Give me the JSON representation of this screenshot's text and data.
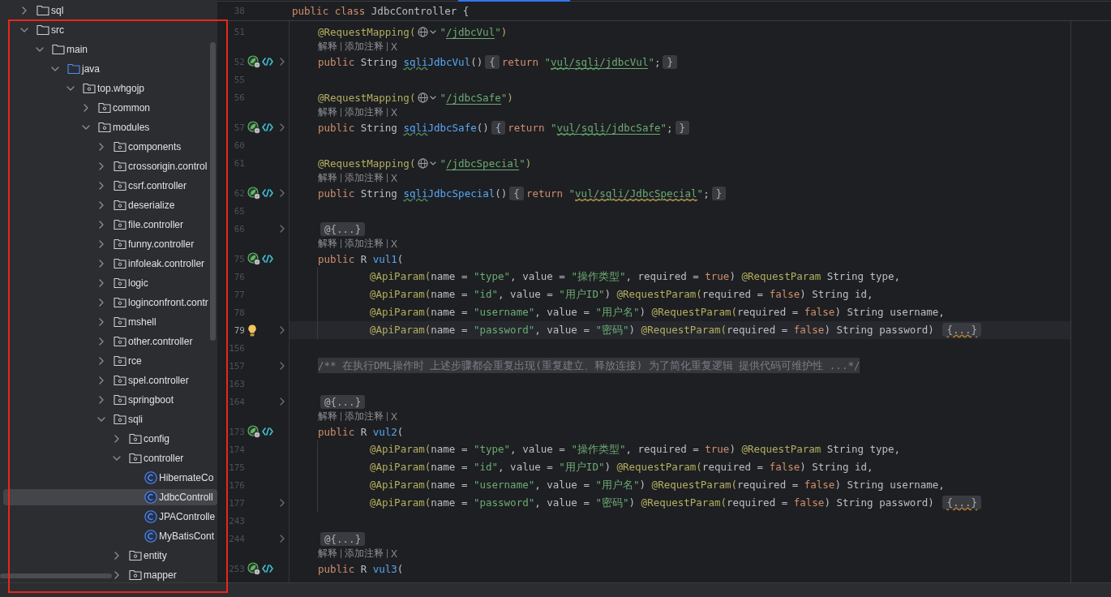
{
  "project_tree": {
    "items": [
      {
        "label": "sql",
        "kind": "folder",
        "expanded": false,
        "selected": false
      },
      {
        "label": "src",
        "kind": "folder",
        "expanded": true,
        "selected": false,
        "children": [
          {
            "label": "main",
            "kind": "folder",
            "expanded": true,
            "selected": false,
            "children": [
              {
                "label": "java",
                "kind": "source-folder",
                "expanded": true,
                "selected": false,
                "children": [
                  {
                    "label": "top.whgojp",
                    "kind": "package",
                    "expanded": true,
                    "selected": false,
                    "children": [
                      {
                        "label": "common",
                        "kind": "package",
                        "expanded": false,
                        "selected": false
                      },
                      {
                        "label": "modules",
                        "kind": "package",
                        "expanded": true,
                        "selected": false,
                        "children": [
                          {
                            "label": "components",
                            "kind": "package",
                            "expanded": false,
                            "selected": false
                          },
                          {
                            "label": "crossorigin.control",
                            "kind": "package",
                            "expanded": false,
                            "selected": false
                          },
                          {
                            "label": "csrf.controller",
                            "kind": "package",
                            "expanded": false,
                            "selected": false
                          },
                          {
                            "label": "deserialize",
                            "kind": "package",
                            "expanded": false,
                            "selected": false
                          },
                          {
                            "label": "file.controller",
                            "kind": "package",
                            "expanded": false,
                            "selected": false
                          },
                          {
                            "label": "funny.controller",
                            "kind": "package",
                            "expanded": false,
                            "selected": false
                          },
                          {
                            "label": "infoleak.controller",
                            "kind": "package",
                            "expanded": false,
                            "selected": false
                          },
                          {
                            "label": "logic",
                            "kind": "package",
                            "expanded": false,
                            "selected": false
                          },
                          {
                            "label": "loginconfront.contr",
                            "kind": "package",
                            "expanded": false,
                            "selected": false
                          },
                          {
                            "label": "mshell",
                            "kind": "package",
                            "expanded": false,
                            "selected": false
                          },
                          {
                            "label": "other.controller",
                            "kind": "package",
                            "expanded": false,
                            "selected": false
                          },
                          {
                            "label": "rce",
                            "kind": "package",
                            "expanded": false,
                            "selected": false
                          },
                          {
                            "label": "spel.controller",
                            "kind": "package",
                            "expanded": false,
                            "selected": false
                          },
                          {
                            "label": "springboot",
                            "kind": "package",
                            "expanded": false,
                            "selected": false
                          },
                          {
                            "label": "sqli",
                            "kind": "package",
                            "expanded": true,
                            "selected": false,
                            "children": [
                              {
                                "label": "config",
                                "kind": "package",
                                "expanded": false,
                                "selected": false
                              },
                              {
                                "label": "controller",
                                "kind": "package",
                                "expanded": true,
                                "selected": false,
                                "children": [
                                  {
                                    "label": "HibernateCo",
                                    "kind": "class",
                                    "selected": false
                                  },
                                  {
                                    "label": "JdbcControll",
                                    "kind": "class",
                                    "selected": true
                                  },
                                  {
                                    "label": "JPAControlle",
                                    "kind": "class",
                                    "selected": false
                                  },
                                  {
                                    "label": "MyBatisCont",
                                    "kind": "class",
                                    "selected": false
                                  }
                                ]
                              },
                              {
                                "label": "entity",
                                "kind": "package",
                                "expanded": false,
                                "selected": false
                              },
                              {
                                "label": "mapper",
                                "kind": "package",
                                "expanded": false,
                                "selected": false
                              }
                            ]
                          }
                        ]
                      }
                    ]
                  }
                ]
              }
            ]
          }
        ]
      }
    ]
  },
  "editor": {
    "sticky_line": {
      "number": "38",
      "kind": "header",
      "tokens": [
        {
          "kind": "keyword",
          "text": "public class "
        },
        {
          "kind": "plain",
          "text": "JdbcController {"
        }
      ]
    },
    "lines": [
      {
        "number": "51",
        "kind": "member",
        "current": false,
        "folded": false,
        "tokens": [
          {
            "kind": "annotation",
            "text": "@RequestMapping("
          },
          {
            "kind": "url-picker"
          },
          {
            "kind": "string",
            "text": "\""
          },
          {
            "kind": "url",
            "text": "/jdbcVul"
          },
          {
            "kind": "string",
            "text": "\""
          },
          {
            "kind": "annotation",
            "text": ")"
          }
        ]
      },
      {
        "kind": "inlay",
        "actions": [
          "解释",
          "添加注释",
          "X"
        ]
      },
      {
        "number": "52",
        "kind": "member",
        "gutter": {
          "kind": "endpoint"
        },
        "current": false,
        "folded": true,
        "tokens": [
          {
            "kind": "keyword",
            "text": "public "
          },
          {
            "kind": "plain",
            "text": "String "
          },
          {
            "kind": "method-typo",
            "text": "sqli"
          },
          {
            "kind": "method",
            "text": "JdbcVul"
          },
          {
            "kind": "plain",
            "text": "()"
          },
          {
            "kind": "fold",
            "text": "{"
          },
          {
            "kind": "keyword",
            "text": "return "
          },
          {
            "kind": "string",
            "text": "\""
          },
          {
            "kind": "url-typo",
            "text": "vul"
          },
          {
            "kind": "url",
            "text": "/"
          },
          {
            "kind": "url-typo",
            "text": "sqli"
          },
          {
            "kind": "url",
            "text": "/jdbcVul"
          },
          {
            "kind": "string",
            "text": "\""
          },
          {
            "kind": "plain",
            "text": ";"
          },
          {
            "kind": "fold",
            "text": "}"
          }
        ]
      },
      {
        "number": "55",
        "kind": "blank",
        "current": false,
        "folded": false
      },
      {
        "number": "56",
        "kind": "member",
        "current": false,
        "folded": false,
        "tokens": [
          {
            "kind": "annotation",
            "text": "@RequestMapping("
          },
          {
            "kind": "url-picker"
          },
          {
            "kind": "string",
            "text": "\""
          },
          {
            "kind": "url",
            "text": "/jdbcSafe"
          },
          {
            "kind": "string",
            "text": "\""
          },
          {
            "kind": "annotation",
            "text": ")"
          }
        ]
      },
      {
        "kind": "inlay",
        "actions": [
          "解释",
          "添加注释",
          "X"
        ]
      },
      {
        "number": "57",
        "kind": "member",
        "gutter": {
          "kind": "endpoint"
        },
        "current": false,
        "folded": true,
        "tokens": [
          {
            "kind": "keyword",
            "text": "public "
          },
          {
            "kind": "plain",
            "text": "String "
          },
          {
            "kind": "method-typo",
            "text": "sqli"
          },
          {
            "kind": "method",
            "text": "JdbcSafe"
          },
          {
            "kind": "plain",
            "text": "()"
          },
          {
            "kind": "fold",
            "text": "{"
          },
          {
            "kind": "keyword",
            "text": "return "
          },
          {
            "kind": "string",
            "text": "\""
          },
          {
            "kind": "url-typo",
            "text": "vul"
          },
          {
            "kind": "url",
            "text": "/"
          },
          {
            "kind": "url-typo",
            "text": "sqli"
          },
          {
            "kind": "url",
            "text": "/jdbcSafe"
          },
          {
            "kind": "string",
            "text": "\""
          },
          {
            "kind": "plain",
            "text": ";"
          },
          {
            "kind": "fold",
            "text": "}"
          }
        ]
      },
      {
        "number": "60",
        "kind": "blank",
        "current": false,
        "folded": false
      },
      {
        "number": "61",
        "kind": "member",
        "current": false,
        "folded": false,
        "tokens": [
          {
            "kind": "annotation",
            "text": "@RequestMapping("
          },
          {
            "kind": "url-picker"
          },
          {
            "kind": "string",
            "text": "\""
          },
          {
            "kind": "url",
            "text": "/jdbcSpecial"
          },
          {
            "kind": "string",
            "text": "\""
          },
          {
            "kind": "annotation",
            "text": ")"
          }
        ]
      },
      {
        "kind": "inlay",
        "actions": [
          "解释",
          "添加注释",
          "X"
        ]
      },
      {
        "number": "62",
        "kind": "member",
        "gutter": {
          "kind": "endpoint"
        },
        "current": false,
        "folded": true,
        "tokens": [
          {
            "kind": "keyword",
            "text": "public "
          },
          {
            "kind": "plain",
            "text": "String "
          },
          {
            "kind": "method-typo",
            "text": "sqli"
          },
          {
            "kind": "method",
            "text": "JdbcSpecial"
          },
          {
            "kind": "plain",
            "text": "()"
          },
          {
            "kind": "fold",
            "text": "{"
          },
          {
            "kind": "keyword",
            "text": "return "
          },
          {
            "kind": "string",
            "text": "\""
          },
          {
            "kind": "url-warn",
            "text": "vul/sqli/JdbcSpecial"
          },
          {
            "kind": "string",
            "text": "\""
          },
          {
            "kind": "plain",
            "text": ";"
          },
          {
            "kind": "fold",
            "text": "}"
          }
        ]
      },
      {
        "number": "65",
        "kind": "blank",
        "current": false,
        "folded": false
      },
      {
        "number": "66",
        "kind": "member",
        "current": false,
        "folded": true,
        "tokens": [
          {
            "kind": "fold",
            "text": "@{...}"
          }
        ]
      },
      {
        "kind": "inlay",
        "actions": [
          "解释",
          "添加注释",
          "X"
        ]
      },
      {
        "number": "75",
        "kind": "member",
        "gutter": {
          "kind": "endpoint"
        },
        "current": false,
        "folded": false,
        "tokens": [
          {
            "kind": "keyword",
            "text": "public "
          },
          {
            "kind": "plain",
            "text": "R "
          },
          {
            "kind": "method",
            "text": "vul1"
          },
          {
            "kind": "plain",
            "text": "("
          }
        ]
      },
      {
        "number": "76",
        "kind": "param",
        "current": false,
        "folded": false,
        "tokens": [
          {
            "kind": "annotation",
            "text": "@ApiParam("
          },
          {
            "kind": "plain",
            "text": "name = "
          },
          {
            "kind": "string",
            "text": "\"type\""
          },
          {
            "kind": "plain",
            "text": ", value = "
          },
          {
            "kind": "string",
            "text": "\"操作类型\""
          },
          {
            "kind": "plain",
            "text": ", required = "
          },
          {
            "kind": "keyword",
            "text": "true"
          },
          {
            "kind": "plain",
            "text": ") "
          },
          {
            "kind": "annotation",
            "text": "@RequestParam"
          },
          {
            "kind": "plain",
            "text": " String type,"
          }
        ]
      },
      {
        "number": "77",
        "kind": "param",
        "current": false,
        "folded": false,
        "tokens": [
          {
            "kind": "annotation",
            "text": "@ApiParam("
          },
          {
            "kind": "plain",
            "text": "name = "
          },
          {
            "kind": "string",
            "text": "\"id\""
          },
          {
            "kind": "plain",
            "text": ", value = "
          },
          {
            "kind": "string",
            "text": "\"用户ID\""
          },
          {
            "kind": "plain",
            "text": ") "
          },
          {
            "kind": "annotation",
            "text": "@RequestParam("
          },
          {
            "kind": "plain",
            "text": "required = "
          },
          {
            "kind": "keyword",
            "text": "false"
          },
          {
            "kind": "plain",
            "text": ") String id,"
          }
        ]
      },
      {
        "number": "78",
        "kind": "param",
        "current": false,
        "folded": false,
        "tokens": [
          {
            "kind": "annotation",
            "text": "@ApiParam("
          },
          {
            "kind": "plain",
            "text": "name = "
          },
          {
            "kind": "string",
            "text": "\"username\""
          },
          {
            "kind": "plain",
            "text": ", value = "
          },
          {
            "kind": "string",
            "text": "\"用户名\""
          },
          {
            "kind": "plain",
            "text": ") "
          },
          {
            "kind": "annotation",
            "text": "@RequestParam("
          },
          {
            "kind": "plain",
            "text": "required = "
          },
          {
            "kind": "keyword",
            "text": "false"
          },
          {
            "kind": "plain",
            "text": ") String username,"
          }
        ]
      },
      {
        "number": "79",
        "kind": "param",
        "gutter": {
          "kind": "hint"
        },
        "current": true,
        "folded": true,
        "tokens": [
          {
            "kind": "annotation",
            "text": "@ApiParam("
          },
          {
            "kind": "plain",
            "text": "name = "
          },
          {
            "kind": "string",
            "text": "\"password\""
          },
          {
            "kind": "plain",
            "text": ", value = "
          },
          {
            "kind": "string",
            "text": "\"密码\""
          },
          {
            "kind": "plain",
            "text": ") "
          },
          {
            "kind": "annotation",
            "text": "@RequestParam("
          },
          {
            "kind": "plain",
            "text": "required = "
          },
          {
            "kind": "keyword",
            "text": "false"
          },
          {
            "kind": "plain",
            "text": ") String password) "
          },
          {
            "kind": "fold-warn",
            "text": "{...}"
          }
        ]
      },
      {
        "number": "156",
        "kind": "blank",
        "current": false,
        "folded": false
      },
      {
        "number": "157",
        "kind": "member",
        "current": false,
        "folded": true,
        "tokens": [
          {
            "kind": "comment-fold",
            "text": "/** 在执行DML操作时 上述步骤都会重复出现(重复建立、释放连接) 为了简化重复逻辑 提供代码可维护性 ...*/"
          }
        ]
      },
      {
        "number": "163",
        "kind": "blank",
        "current": false,
        "folded": false
      },
      {
        "number": "164",
        "kind": "member",
        "current": false,
        "folded": true,
        "tokens": [
          {
            "kind": "fold",
            "text": "@{...}"
          }
        ]
      },
      {
        "kind": "inlay",
        "actions": [
          "解释",
          "添加注释",
          "X"
        ]
      },
      {
        "number": "173",
        "kind": "member",
        "gutter": {
          "kind": "endpoint"
        },
        "current": false,
        "folded": false,
        "tokens": [
          {
            "kind": "keyword",
            "text": "public "
          },
          {
            "kind": "plain",
            "text": "R "
          },
          {
            "kind": "method",
            "text": "vul2"
          },
          {
            "kind": "plain",
            "text": "("
          }
        ]
      },
      {
        "number": "174",
        "kind": "param",
        "current": false,
        "folded": false,
        "tokens": [
          {
            "kind": "annotation",
            "text": "@ApiParam("
          },
          {
            "kind": "plain",
            "text": "name = "
          },
          {
            "kind": "string",
            "text": "\"type\""
          },
          {
            "kind": "plain",
            "text": ", value = "
          },
          {
            "kind": "string",
            "text": "\"操作类型\""
          },
          {
            "kind": "plain",
            "text": ", required = "
          },
          {
            "kind": "keyword",
            "text": "true"
          },
          {
            "kind": "plain",
            "text": ") "
          },
          {
            "kind": "annotation",
            "text": "@RequestParam"
          },
          {
            "kind": "plain",
            "text": " String type,"
          }
        ]
      },
      {
        "number": "175",
        "kind": "param",
        "current": false,
        "folded": false,
        "tokens": [
          {
            "kind": "annotation",
            "text": "@ApiParam("
          },
          {
            "kind": "plain",
            "text": "name = "
          },
          {
            "kind": "string",
            "text": "\"id\""
          },
          {
            "kind": "plain",
            "text": ", value = "
          },
          {
            "kind": "string",
            "text": "\"用户ID\""
          },
          {
            "kind": "plain",
            "text": ") "
          },
          {
            "kind": "annotation",
            "text": "@RequestParam("
          },
          {
            "kind": "plain",
            "text": "required = "
          },
          {
            "kind": "keyword",
            "text": "false"
          },
          {
            "kind": "plain",
            "text": ") String id,"
          }
        ]
      },
      {
        "number": "176",
        "kind": "param",
        "current": false,
        "folded": false,
        "tokens": [
          {
            "kind": "annotation",
            "text": "@ApiParam("
          },
          {
            "kind": "plain",
            "text": "name = "
          },
          {
            "kind": "string",
            "text": "\"username\""
          },
          {
            "kind": "plain",
            "text": ", value = "
          },
          {
            "kind": "string",
            "text": "\"用户名\""
          },
          {
            "kind": "plain",
            "text": ") "
          },
          {
            "kind": "annotation",
            "text": "@RequestParam("
          },
          {
            "kind": "plain",
            "text": "required = "
          },
          {
            "kind": "keyword",
            "text": "false"
          },
          {
            "kind": "plain",
            "text": ") String username,"
          }
        ]
      },
      {
        "number": "177",
        "kind": "param",
        "current": false,
        "folded": true,
        "tokens": [
          {
            "kind": "annotation",
            "text": "@ApiParam("
          },
          {
            "kind": "plain",
            "text": "name = "
          },
          {
            "kind": "string",
            "text": "\"password\""
          },
          {
            "kind": "plain",
            "text": ", value = "
          },
          {
            "kind": "string",
            "text": "\"密码\""
          },
          {
            "kind": "plain",
            "text": ") "
          },
          {
            "kind": "annotation",
            "text": "@RequestParam("
          },
          {
            "kind": "plain",
            "text": "required = "
          },
          {
            "kind": "keyword",
            "text": "false"
          },
          {
            "kind": "plain",
            "text": ") String password) "
          },
          {
            "kind": "fold-warn",
            "text": "{...}"
          }
        ]
      },
      {
        "number": "243",
        "kind": "blank",
        "current": false,
        "folded": false
      },
      {
        "number": "244",
        "kind": "member",
        "current": false,
        "folded": true,
        "tokens": [
          {
            "kind": "fold",
            "text": "@{...}"
          }
        ]
      },
      {
        "kind": "inlay",
        "actions": [
          "解释",
          "添加注释",
          "X"
        ]
      },
      {
        "number": "253",
        "kind": "member",
        "gutter": {
          "kind": "endpoint"
        },
        "current": false,
        "folded": false,
        "tokens": [
          {
            "kind": "keyword",
            "text": "public "
          },
          {
            "kind": "plain",
            "text": "R "
          },
          {
            "kind": "method",
            "text": "vul3"
          },
          {
            "kind": "plain",
            "text": "("
          }
        ]
      }
    ]
  }
}
